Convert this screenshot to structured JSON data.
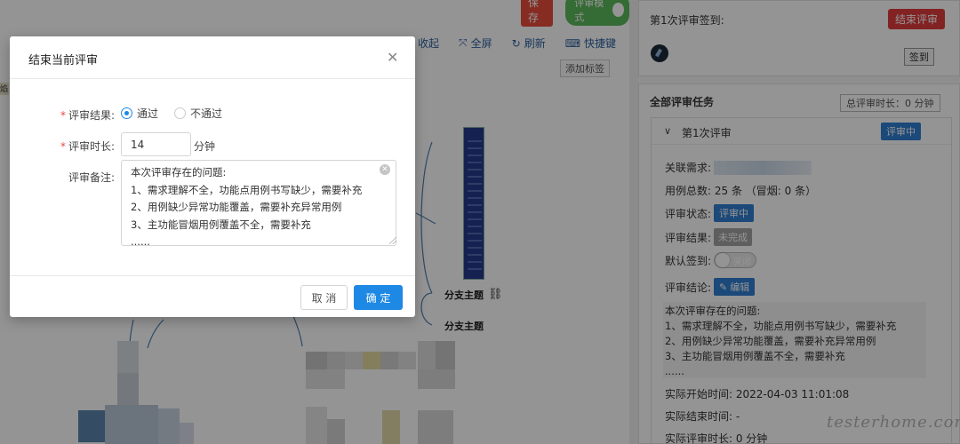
{
  "topbar": {
    "save_label": "保存",
    "mode_label": "评审模式"
  },
  "toolbar": {
    "collapse": "收起",
    "fullscreen": "全屏",
    "refresh": "刷新",
    "shortcut": "快捷键",
    "add_tag": "添加标签"
  },
  "mindmap": {
    "node_branch_1": "分支主题",
    "node_branch_2": "分支主题",
    "cut_label": "焰"
  },
  "sign_panel": {
    "title": "第1次评审签到:",
    "end_review": "结束评审",
    "sign_button": "签到"
  },
  "tasks": {
    "title": "全部评审任务",
    "total_time": "总评审时长：0 分钟",
    "review": {
      "name": "第1次评审",
      "status_badge": "评审中",
      "linked_req_label": "关联需求:",
      "case_total": "用例总数: 25 条 （冒烟: 0 条）",
      "status_label": "评审状态:",
      "status_value": "评审中",
      "result_label": "评审结果:",
      "result_value": "未完成",
      "default_sign_label": "默认签到:",
      "default_sign_value": "关闭",
      "conclusion_label": "评审结论:",
      "edit_button": "编辑",
      "conclusion_lines": [
        "本次评审存在的问题:",
        "1、需求理解不全，功能点用例书写缺少，需要补充",
        "2、用例缺少异常功能覆盖，需要补充异常用例",
        "3、主功能冒烟用例覆盖不全，需要补充",
        "......"
      ],
      "start_time": "实际开始时间: 2022-04-03 11:01:08",
      "end_time": "实际结束时间: -",
      "duration": "实际评审时长: 0 分钟"
    }
  },
  "watermark": "testerhome.com",
  "modal": {
    "title": "结束当前评审",
    "result_label": "评审结果:",
    "options": [
      "通过",
      "不通过"
    ],
    "selected": "通过",
    "duration_label": "评审时长:",
    "duration_value": "14",
    "duration_unit": "分钟",
    "remark_label": "评审备注:",
    "remark_value": "本次评审存在的问题:\n1、需求理解不全，功能点用例书写缺少，需要补充\n2、用例缺少异常功能覆盖，需要补充异常用例\n3、主功能冒烟用例覆盖不全，需要补充\n......",
    "cancel_label": "取 消",
    "ok_label": "确 定"
  },
  "colors": {
    "primary": "#1e88e5",
    "danger": "#e03b3b",
    "success": "#5cb85c",
    "mask": "rgba(0,0,0,0.42)"
  }
}
